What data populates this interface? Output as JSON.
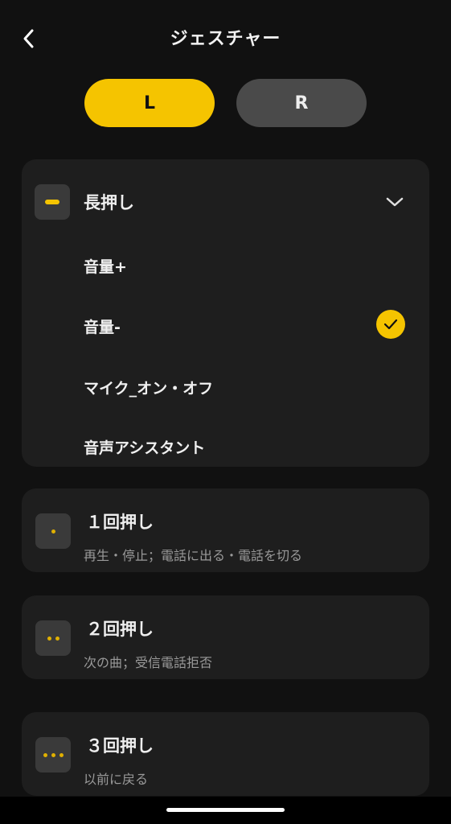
{
  "header": {
    "title": "ジェスチャー",
    "back_icon": "chevron-left-icon"
  },
  "tabs": [
    {
      "label": "L",
      "selected": true
    },
    {
      "label": "R",
      "selected": false
    }
  ],
  "long_press": {
    "title": "長押し",
    "options": [
      {
        "label": "音量+",
        "selected": false
      },
      {
        "label": "音量-",
        "selected": true
      },
      {
        "label": "マイク_オン・オフ",
        "selected": false
      },
      {
        "label": "音声アシスタント",
        "selected": false
      }
    ]
  },
  "gestures": [
    {
      "title": "１回押し",
      "subtitle": "再生・停止；電話に出る・電話を切る",
      "dots": 1
    },
    {
      "title": "２回押し",
      "subtitle": "次の曲；受信電話拒否",
      "dots": 2
    },
    {
      "title": "３回押し",
      "subtitle": "以前に戻る",
      "dots": 3
    }
  ],
  "colors": {
    "accent": "#f5c400",
    "background": "#111111",
    "card": "#1e1e1e",
    "inactive_tab": "#4a4a4a"
  }
}
